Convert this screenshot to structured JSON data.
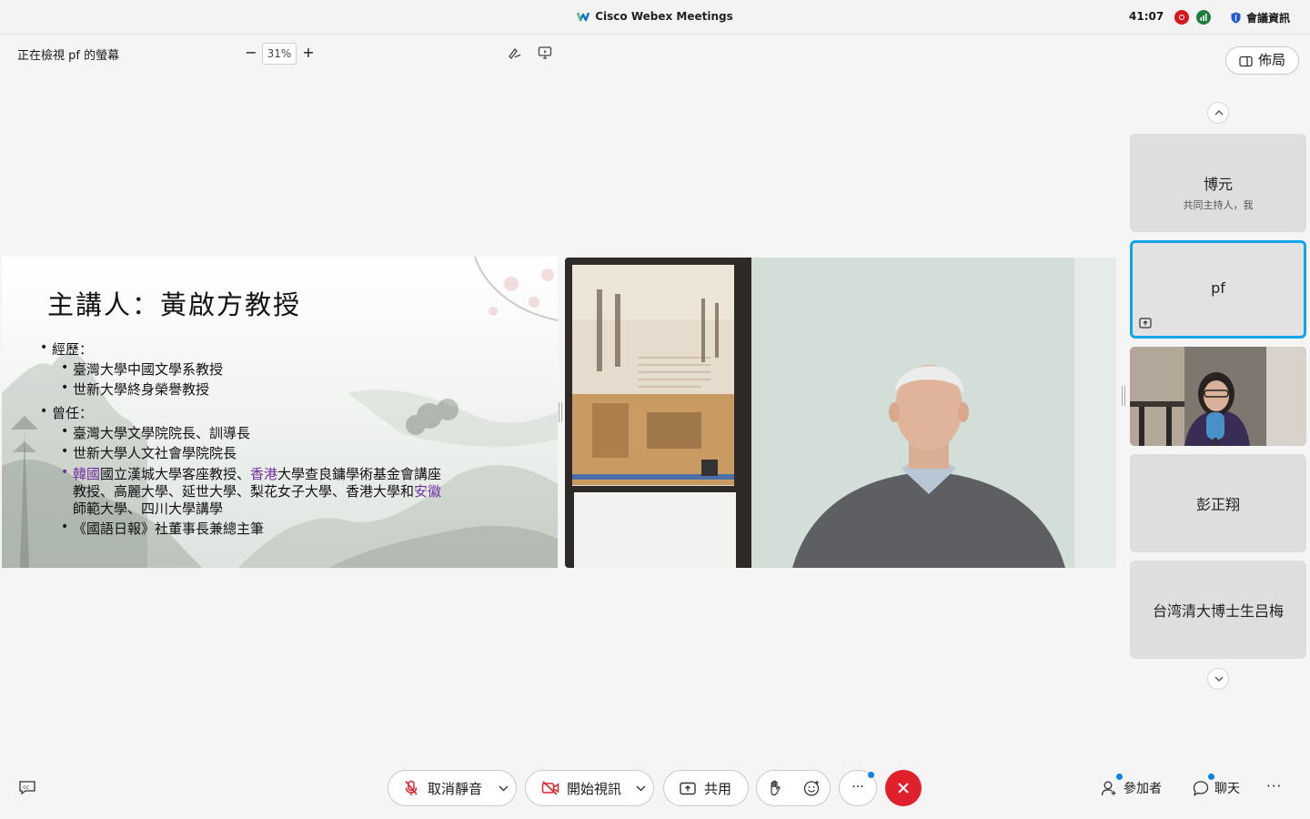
{
  "titlebar": {
    "app_title": "Cisco Webex Meetings",
    "timer": "41:07",
    "meeting_info": "會議資訊"
  },
  "viewbar": {
    "viewing_label": "正在檢視 pf 的螢幕",
    "zoom_minus": "−",
    "zoom_value": "31%",
    "zoom_plus": "+",
    "layout_label": "佈局"
  },
  "slide": {
    "title": "主講人：黃啟方教授",
    "section_experience": "經歷：",
    "experience": [
      "臺灣大學中國文學系教授",
      "世新大學終身榮譽教授"
    ],
    "section_former": "曾任：",
    "former_1": "臺灣大學文學院院長、訓導長",
    "former_2": "世新大學人文社會學院院長",
    "former_3_part1": "韓國",
    "former_3_part2": "國立漢城大學客座教授、",
    "former_3_part3": "香港",
    "former_3_part4": "大學查良鏞學術基金會講座",
    "former_3_line2a": "教授、高麗大學、延世大學、梨花女子大學、香港大學和",
    "former_3_line2b": "安徽",
    "former_3_line3": "師範大學、四川大學講學",
    "former_4": "《國語日報》社董事長兼總主筆"
  },
  "participants": [
    {
      "name": "博元",
      "role": "共同主持人，我"
    },
    {
      "name": "pf"
    },
    {
      "name": "彭正翔"
    },
    {
      "name": "台湾清大博士生吕梅"
    }
  ],
  "controls": {
    "unmute_label": "取消靜音",
    "start_video_label": "開始視訊",
    "share_label": "共用",
    "more_label": "···",
    "participants_label": "參加者",
    "chat_label": "聊天",
    "more_right": "···"
  },
  "colors": {
    "accent": "#0ea5e9",
    "end_call": "#e0212b",
    "record": "#d8171c",
    "slide_highlight": "#7030a0",
    "notify_dot": "#0b84e6"
  }
}
